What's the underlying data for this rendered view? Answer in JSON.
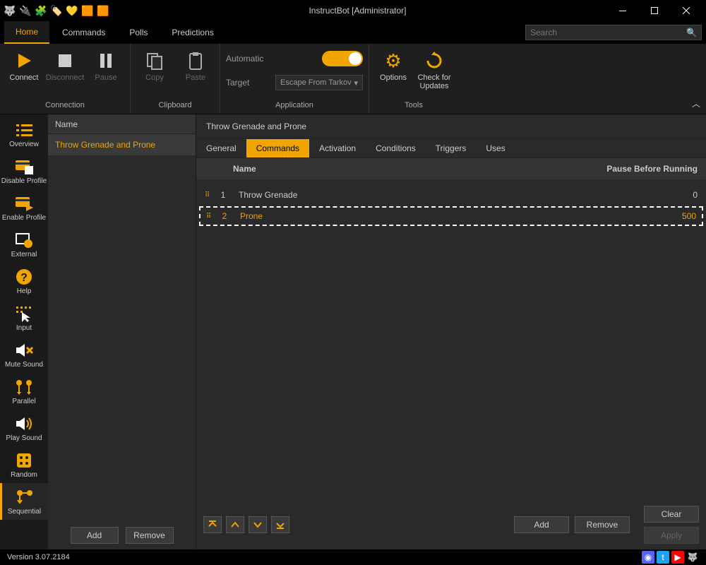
{
  "window": {
    "title": "InstructBot [Administrator]"
  },
  "menuTabs": [
    "Home",
    "Commands",
    "Polls",
    "Predictions"
  ],
  "menuActive": "Home",
  "search": {
    "placeholder": "Search"
  },
  "ribbon": {
    "connection": {
      "label": "Connection",
      "connect": "Connect",
      "disconnect": "Disconnect",
      "pause": "Pause"
    },
    "clipboard": {
      "label": "Clipboard",
      "copy": "Copy",
      "paste": "Paste"
    },
    "application": {
      "label": "Application",
      "automatic": "Automatic",
      "target": "Target",
      "targetValue": "Escape From Tarkov"
    },
    "tools": {
      "label": "Tools",
      "options": "Options",
      "checkUpdates": "Check for\nUpdates"
    }
  },
  "sidebar": [
    {
      "label": "Overview"
    },
    {
      "label": "Disable Profile"
    },
    {
      "label": "Enable Profile"
    },
    {
      "label": "External"
    },
    {
      "label": "Help"
    },
    {
      "label": "Input"
    },
    {
      "label": "Mute Sound"
    },
    {
      "label": "Parallel"
    },
    {
      "label": "Play Sound"
    },
    {
      "label": "Random"
    },
    {
      "label": "Sequential"
    }
  ],
  "sidebarActive": "Sequential",
  "profilePanel": {
    "header": "Name",
    "items": [
      "Throw Grenade and Prone"
    ],
    "add": "Add",
    "remove": "Remove"
  },
  "detail": {
    "title": "Throw Grenade and Prone",
    "tabs": [
      "General",
      "Commands",
      "Activation",
      "Conditions",
      "Triggers",
      "Uses"
    ],
    "tabActive": "Commands",
    "columns": {
      "name": "Name",
      "pause": "Pause Before Running"
    },
    "rows": [
      {
        "idx": "1",
        "name": "Throw Grenade",
        "pause": "0",
        "selected": false
      },
      {
        "idx": "2",
        "name": "Prone",
        "pause": "500",
        "selected": true
      }
    ],
    "footer": {
      "add": "Add",
      "remove": "Remove",
      "clear": "Clear",
      "apply": "Apply"
    }
  },
  "status": {
    "version": "Version 3.07.2184"
  }
}
